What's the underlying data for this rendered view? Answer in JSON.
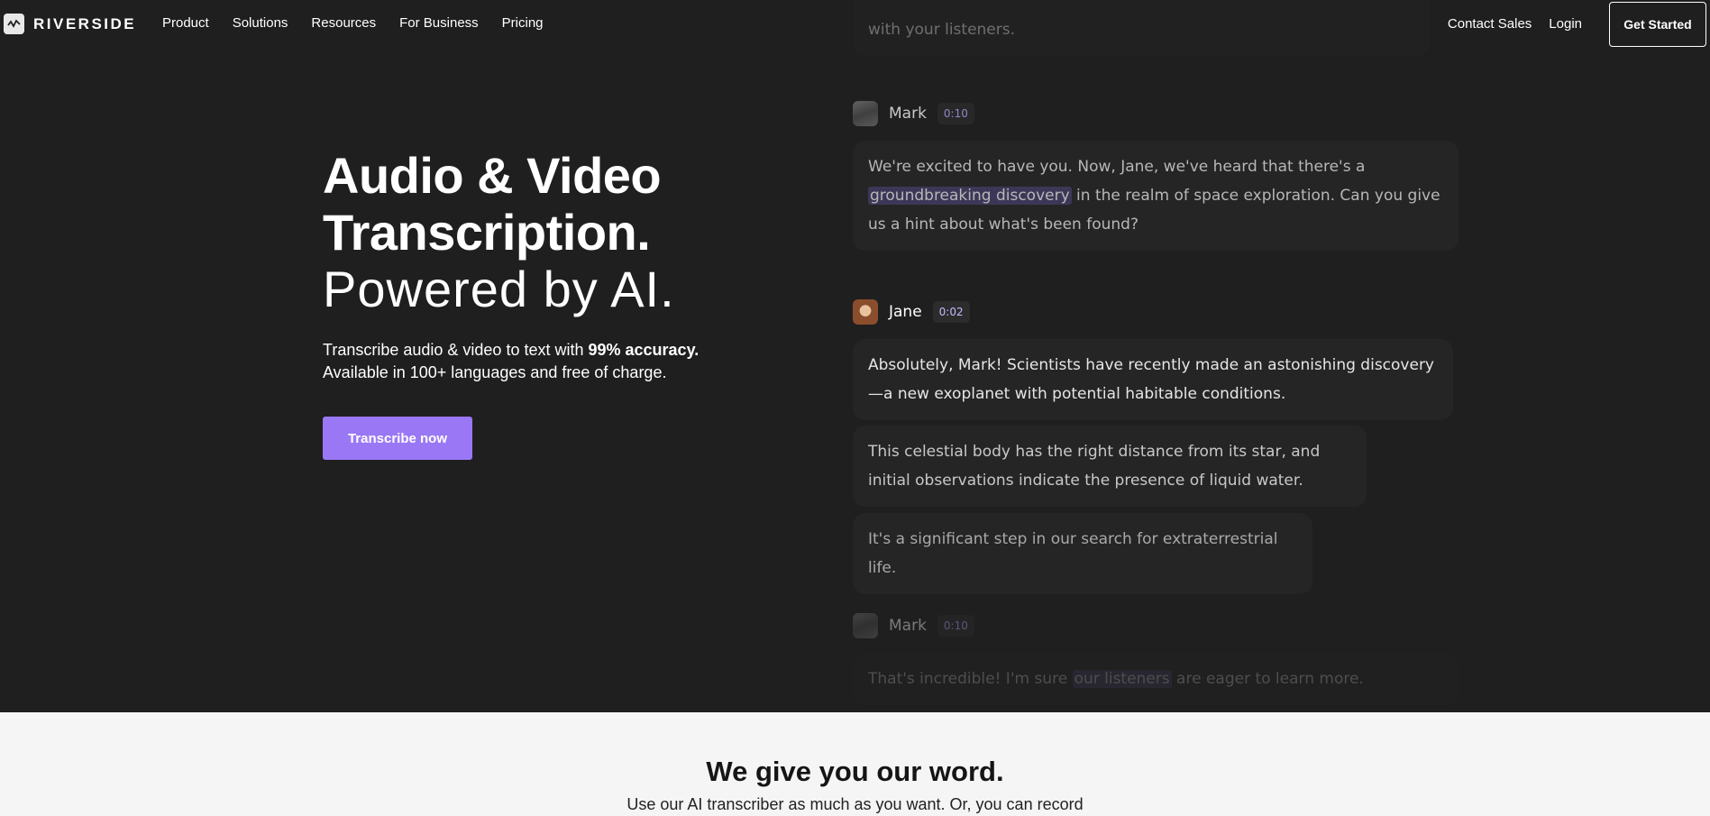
{
  "nav": {
    "logo_text": "RIVERSIDE",
    "links": [
      "Product",
      "Solutions",
      "Resources",
      "For Business",
      "Pricing"
    ],
    "contact": "Contact Sales",
    "login": "Login",
    "get_started": "Get Started"
  },
  "hero": {
    "title_line1": "Audio & Video",
    "title_line2": "Transcription.",
    "title_line3": "Powered by AI.",
    "sub_part1": "Transcribe audio & video to text with ",
    "sub_bold": "99% accuracy.",
    "sub_line2": "Available in 100+ languages and free of charge.",
    "cta": "Transcribe now"
  },
  "transcript": {
    "top_faded": [
      "with your listeners."
    ],
    "mark1": {
      "name": "Mark",
      "time": "0:10",
      "text_pre": "We're excited to have you. Now, Jane, we've heard that there's a ",
      "highlight": "groundbreaking discovery",
      "text_post": " in the realm of space exploration. Can you give us a hint about what's been found?"
    },
    "jane": {
      "name": "Jane",
      "time": "0:02",
      "bubble1": "Absolutely, Mark! Scientists have recently made an astonishing discovery—a new exoplanet with potential habitable conditions.",
      "bubble2": " This celestial body has the right distance from its star, and initial observations indicate the presence of liquid water.",
      "bubble3": " It's a significant step in our search for extraterrestrial life."
    },
    "mark2": {
      "name": "Mark",
      "time": "0:10",
      "text_pre": "That's incredible! I'm sure ",
      "highlight": "our listeners",
      "text_post": " are eager to learn more."
    }
  },
  "bottom": {
    "title": "We give you our word.",
    "subtitle": "Use our AI transcriber as much as you want. Or, you can record"
  },
  "colors": {
    "background": "#1f1f1f",
    "accent": "#9a78f5",
    "bubble": "#252525",
    "highlight": "#3d3757",
    "bottom_bg": "#f5f5f5"
  }
}
